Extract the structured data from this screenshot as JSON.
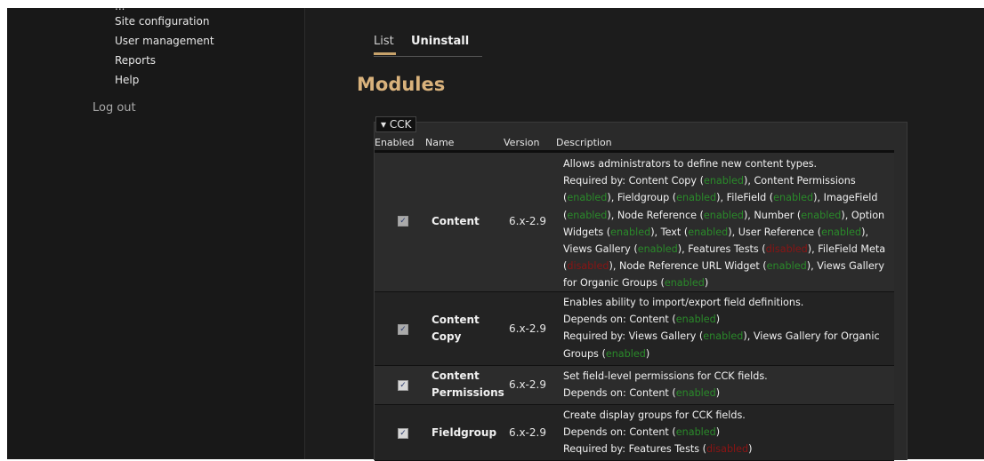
{
  "sidebar": {
    "partial_top_item": "...",
    "items": [
      {
        "label": "Site configuration"
      },
      {
        "label": "User management"
      },
      {
        "label": "Reports"
      },
      {
        "label": "Help"
      }
    ],
    "logout": "Log out"
  },
  "tabs": [
    {
      "label": "List",
      "active": true
    },
    {
      "label": "Uninstall",
      "active": false
    }
  ],
  "page_title": "Modules",
  "fieldset": {
    "legend": "▾ CCK",
    "columns": {
      "enabled": "Enabled",
      "name": "Name",
      "version": "Version",
      "description": "Description"
    }
  },
  "status_words": {
    "enabled": "enabled",
    "disabled": "disabled"
  },
  "colors": {
    "accent": "#c8a36b",
    "enabled": "#2a8a2a",
    "disabled": "#8a1414",
    "title": "#d9b27c"
  },
  "modules": [
    {
      "name": "Content",
      "version": "6.x-2.9",
      "checked": true,
      "description": "Allows administrators to define new content types.",
      "required_by_label": "Required by:",
      "required_by": [
        {
          "name": "Content Copy",
          "status": "enabled"
        },
        {
          "name": "Content Permissions",
          "status": "enabled"
        },
        {
          "name": "Fieldgroup",
          "status": "enabled"
        },
        {
          "name": "FileField",
          "status": "enabled"
        },
        {
          "name": "ImageField",
          "status": "enabled"
        },
        {
          "name": "Node Reference",
          "status": "enabled"
        },
        {
          "name": "Number",
          "status": "enabled"
        },
        {
          "name": "Option Widgets",
          "status": "enabled"
        },
        {
          "name": "Text",
          "status": "enabled"
        },
        {
          "name": "User Reference",
          "status": "enabled"
        },
        {
          "name": "Views Gallery",
          "status": "enabled"
        },
        {
          "name": "Features Tests",
          "status": "disabled"
        },
        {
          "name": "FileField Meta",
          "status": "disabled"
        },
        {
          "name": "Node Reference URL Widget",
          "status": "enabled"
        },
        {
          "name": "Views Gallery for Organic Groups",
          "status": "enabled"
        }
      ]
    },
    {
      "name": "Content Copy",
      "version": "6.x-2.9",
      "checked": true,
      "description": "Enables ability to import/export field definitions.",
      "depends_on_label": "Depends on:",
      "depends_on": [
        {
          "name": "Content",
          "status": "enabled"
        }
      ],
      "required_by_label": "Required by:",
      "required_by": [
        {
          "name": "Views Gallery",
          "status": "enabled"
        },
        {
          "name": "Views Gallery for Organic Groups",
          "status": "enabled"
        }
      ]
    },
    {
      "name": "Content Permissions",
      "version": "6.x-2.9",
      "checked": true,
      "description": "Set field-level permissions for CCK fields.",
      "depends_on_label": "Depends on:",
      "depends_on": [
        {
          "name": "Content",
          "status": "enabled"
        }
      ]
    },
    {
      "name": "Fieldgroup",
      "version": "6.x-2.9",
      "checked": true,
      "description": "Create display groups for CCK fields.",
      "depends_on_label": "Depends on:",
      "depends_on": [
        {
          "name": "Content",
          "status": "enabled"
        }
      ],
      "required_by_label": "Required by:",
      "required_by": [
        {
          "name": "Features Tests",
          "status": "disabled"
        }
      ]
    }
  ]
}
